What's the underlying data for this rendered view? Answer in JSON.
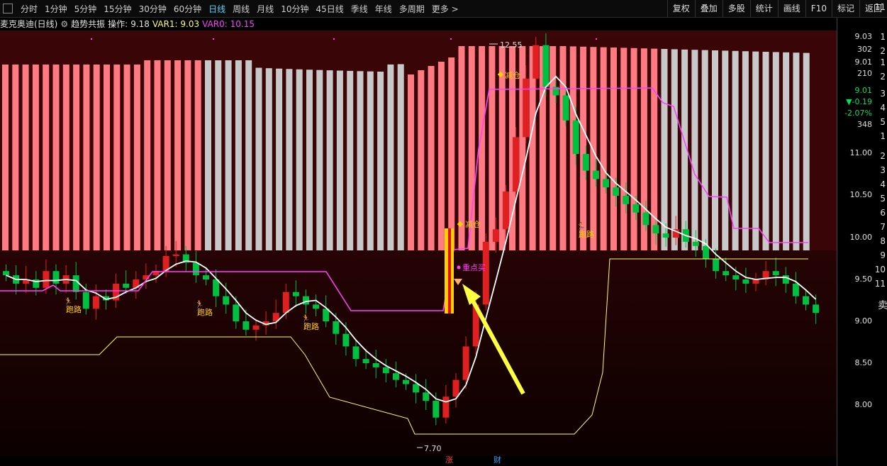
{
  "periods": [
    "分时",
    "1分钟",
    "5分钟",
    "15分钟",
    "30分钟",
    "60分钟",
    "日线",
    "周线",
    "月线",
    "10分钟",
    "45日线",
    "季线",
    "年线",
    "多周期",
    "更多 >"
  ],
  "active_period": "日线",
  "tools": [
    "复权",
    "叠加",
    "多股",
    "统计",
    "画线",
    "F10",
    "标记",
    "返回"
  ],
  "info": {
    "stock": "麦克奥迪(日线)",
    "indicator": "趋势共振",
    "op_label": "操作:",
    "op_value": "9.18",
    "var1": "VAR1: 9.03",
    "var0": "VAR0: 10.15"
  },
  "right_panel": {
    "values": [
      "9.03",
      "302",
      "9.01",
      "210",
      "9.01",
      "▼-0.19",
      "-2.07%",
      "348"
    ],
    "value_colors": [
      "#dddddd",
      "#dddddd",
      "#dddddd",
      "#dddddd",
      "#00e060",
      "#00e060",
      "#00e060",
      "#dddddd"
    ],
    "keys": [
      "11",
      "1",
      "2",
      "1",
      "2",
      "3",
      "4",
      "5",
      "1",
      "2",
      "3",
      "4",
      "5",
      "6",
      "7",
      "8",
      "9",
      "10",
      "11"
    ],
    "sell_label": "卖"
  },
  "price_axis": [
    "11.00",
    "10.50",
    "10.00",
    "9.50",
    "9.00",
    "8.50",
    "8.00"
  ],
  "annotations": {
    "high": "12.55",
    "low": "7.70",
    "reduce1": "减仓",
    "reduce2": "减仓",
    "buy": "重点买",
    "run1": "跑路",
    "run2": "跑路",
    "run3": "跑路",
    "run4": "跑路"
  },
  "bottom_markers": [
    {
      "text": "涨",
      "color": "#ff4040"
    },
    {
      "text": "财",
      "color": "#40a0ff"
    }
  ],
  "colors": {
    "up": "#e02020",
    "down": "#00c040",
    "ma": "#ffffff",
    "band": "#ff40ff",
    "signal": "#ffff60",
    "bar_bull": "#ff7a82",
    "bar_neutral": "#c8c8c8"
  }
}
